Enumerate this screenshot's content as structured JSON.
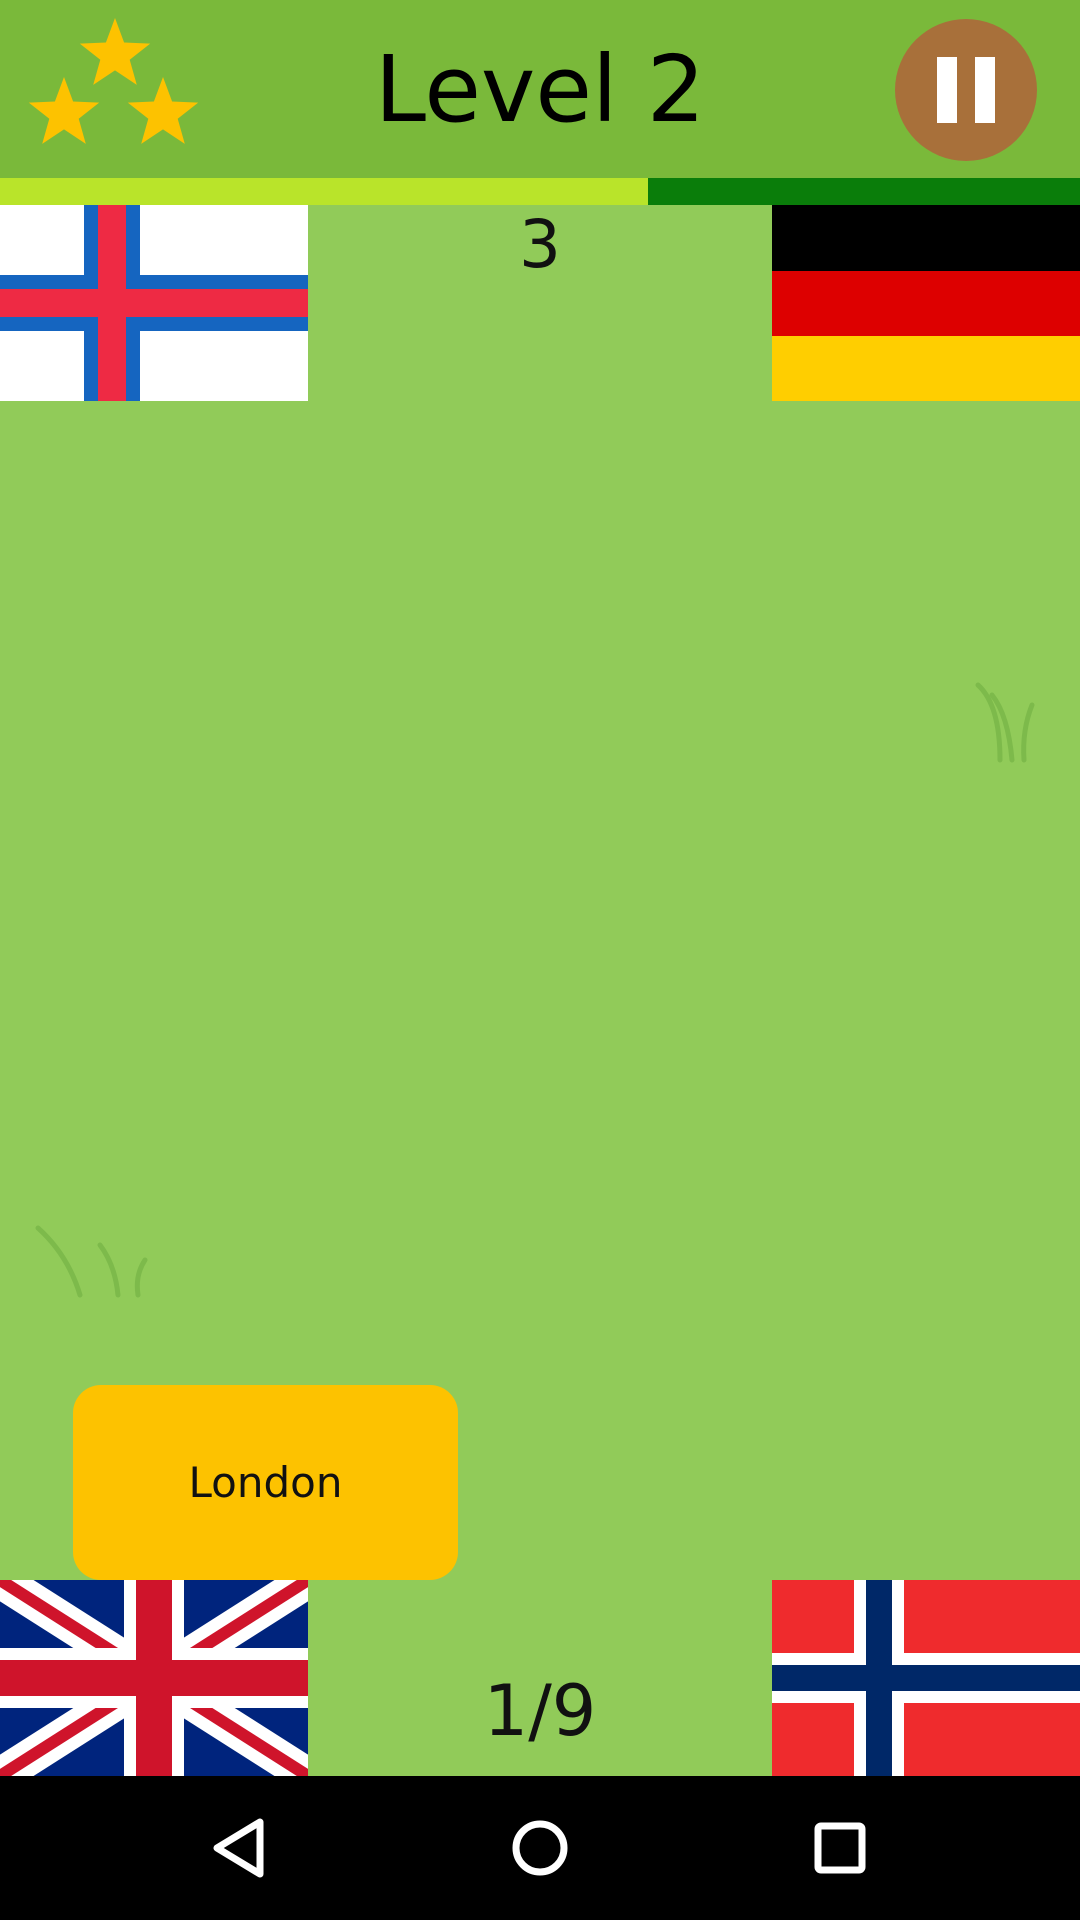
{
  "header": {
    "title": "Level 2",
    "stars_earned": 3,
    "stars_total": 3,
    "pause_icon": "pause-icon"
  },
  "timer": {
    "remaining_fraction": 0.6
  },
  "countdown": "3",
  "flags": {
    "top_left": "faroe-islands-flag",
    "top_right": "germany-flag",
    "bottom_left": "united-kingdom-flag",
    "bottom_right": "norway-flag"
  },
  "capital_card": {
    "label": "London"
  },
  "progress": {
    "text": "1/9"
  },
  "navbar": {
    "back_icon": "back-triangle-icon",
    "home_icon": "home-circle-icon",
    "recents_icon": "recents-square-icon"
  },
  "colors": {
    "header": "#7ab93a",
    "field": "#91cb59",
    "timer_fill": "#b9e42a",
    "timer_track": "#0a7d0a",
    "card": "#fdc200",
    "pause_button": "#a8703a",
    "star": "#fdc200"
  }
}
